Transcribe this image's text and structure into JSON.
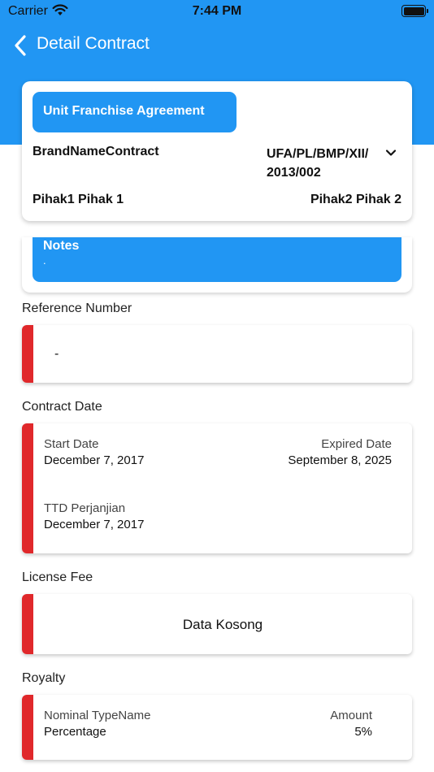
{
  "status_bar": {
    "carrier": "Carrier",
    "time": "7:44 PM"
  },
  "nav": {
    "title": "Detail Contract"
  },
  "contract": {
    "type": "Unit Franchise Agreement",
    "brand": "BrandNameContract",
    "number": "UFA/PL/BMP/XII/ 2013/002",
    "pihak1": "Pihak1 Pihak 1",
    "pihak2": "Pihak2 Pihak 2"
  },
  "notes": {
    "title": "Notes",
    "text": "."
  },
  "reference": {
    "label": "Reference Number",
    "value": "-"
  },
  "contract_date": {
    "label": "Contract Date",
    "start_label": "Start Date",
    "start_value": "December 7, 2017",
    "expired_label": "Expired Date",
    "expired_value": "September 8, 2025",
    "ttd_label": "TTD Perjanjian",
    "ttd_value": "December 7, 2017"
  },
  "license_fee": {
    "label": "License Fee",
    "empty_text": "Data Kosong"
  },
  "royalty": {
    "label": "Royalty",
    "nominal_label": "Nominal TypeName",
    "nominal_value": "Percentage",
    "amount_label": "Amount",
    "amount_value": "5%"
  },
  "colors": {
    "primary": "#2196F3",
    "accent_stripe": "#E0282B"
  }
}
